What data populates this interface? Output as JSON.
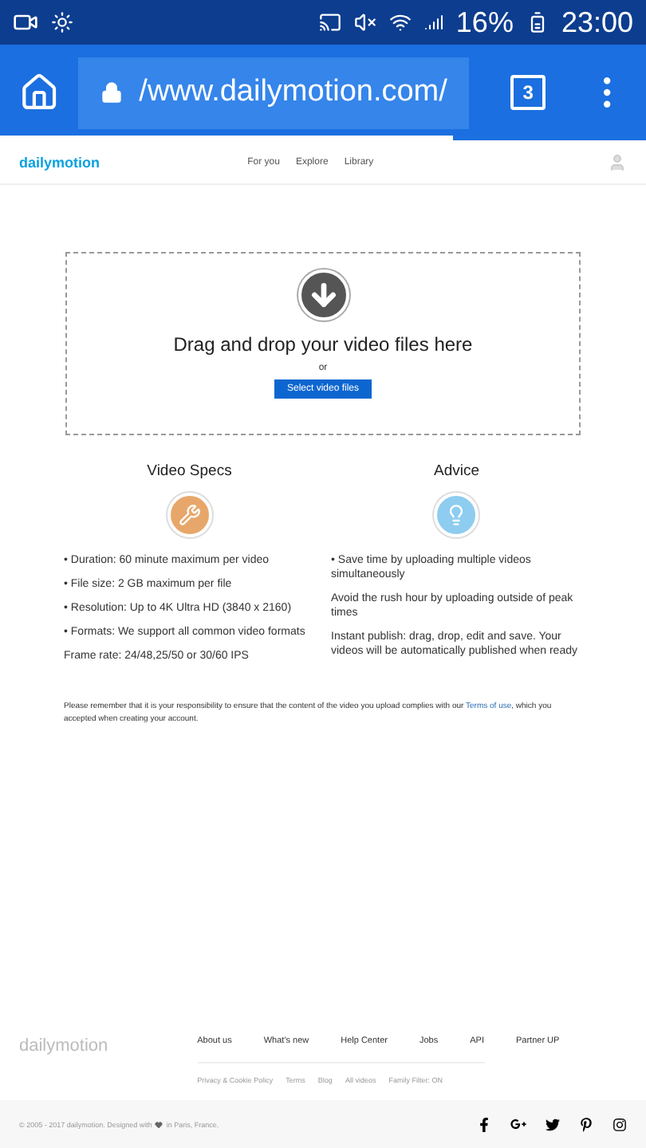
{
  "status_bar": {
    "battery": "16%",
    "time": "23:00"
  },
  "browser": {
    "url": "/www.dailymotion.com/",
    "tab_count": "3",
    "load_progress": {
      "level": 0.7
    }
  },
  "site_nav": {
    "logo": "dailymotion",
    "links": [
      "For you",
      "Explore",
      "Library"
    ]
  },
  "upload": {
    "title": "Drag and drop your video files here",
    "or": "or",
    "button": "Select video files"
  },
  "columns": [
    {
      "kind": "specs",
      "title": "Video Specs",
      "color": "#e8a76a",
      "lines": [
        "• Duration: 60 minute maximum per video",
        "• File size: 2 GB maximum per file",
        "• Resolution: Up to 4K Ultra HD (3840 x 2160)",
        "• Formats: We support all common video formats",
        "Frame rate: 24/48,25/50 or 30/60 IPS"
      ]
    },
    {
      "kind": "advice",
      "title": "Advice",
      "color": "#8ecdf0",
      "lines": [
        "• Save time by uploading multiple videos simultaneously",
        "Avoid the rush hour by uploading outside of peak times",
        "Instant publish: drag, drop, edit and save. Your videos will be automatically published when ready"
      ]
    }
  ],
  "notice": {
    "text": "Please remember that it is your responsibility to ensure that the content of the video you upload complies with our",
    "link": "Terms of use",
    "after": ", which you accepted when creating your account."
  },
  "footer": {
    "logo": "dailymotion",
    "links": [
      "About us",
      "What's new",
      "Help Center",
      "Jobs",
      "API",
      "Partner UP"
    ],
    "sub_links": [
      "Privacy & Cookie Policy",
      "Terms",
      "Blog",
      "All videos",
      "Family Filter: ON"
    ],
    "copyright_before": "© 2005 - 2017 dailymotion. Designed with",
    "copyright_after": "in Paris, France."
  }
}
